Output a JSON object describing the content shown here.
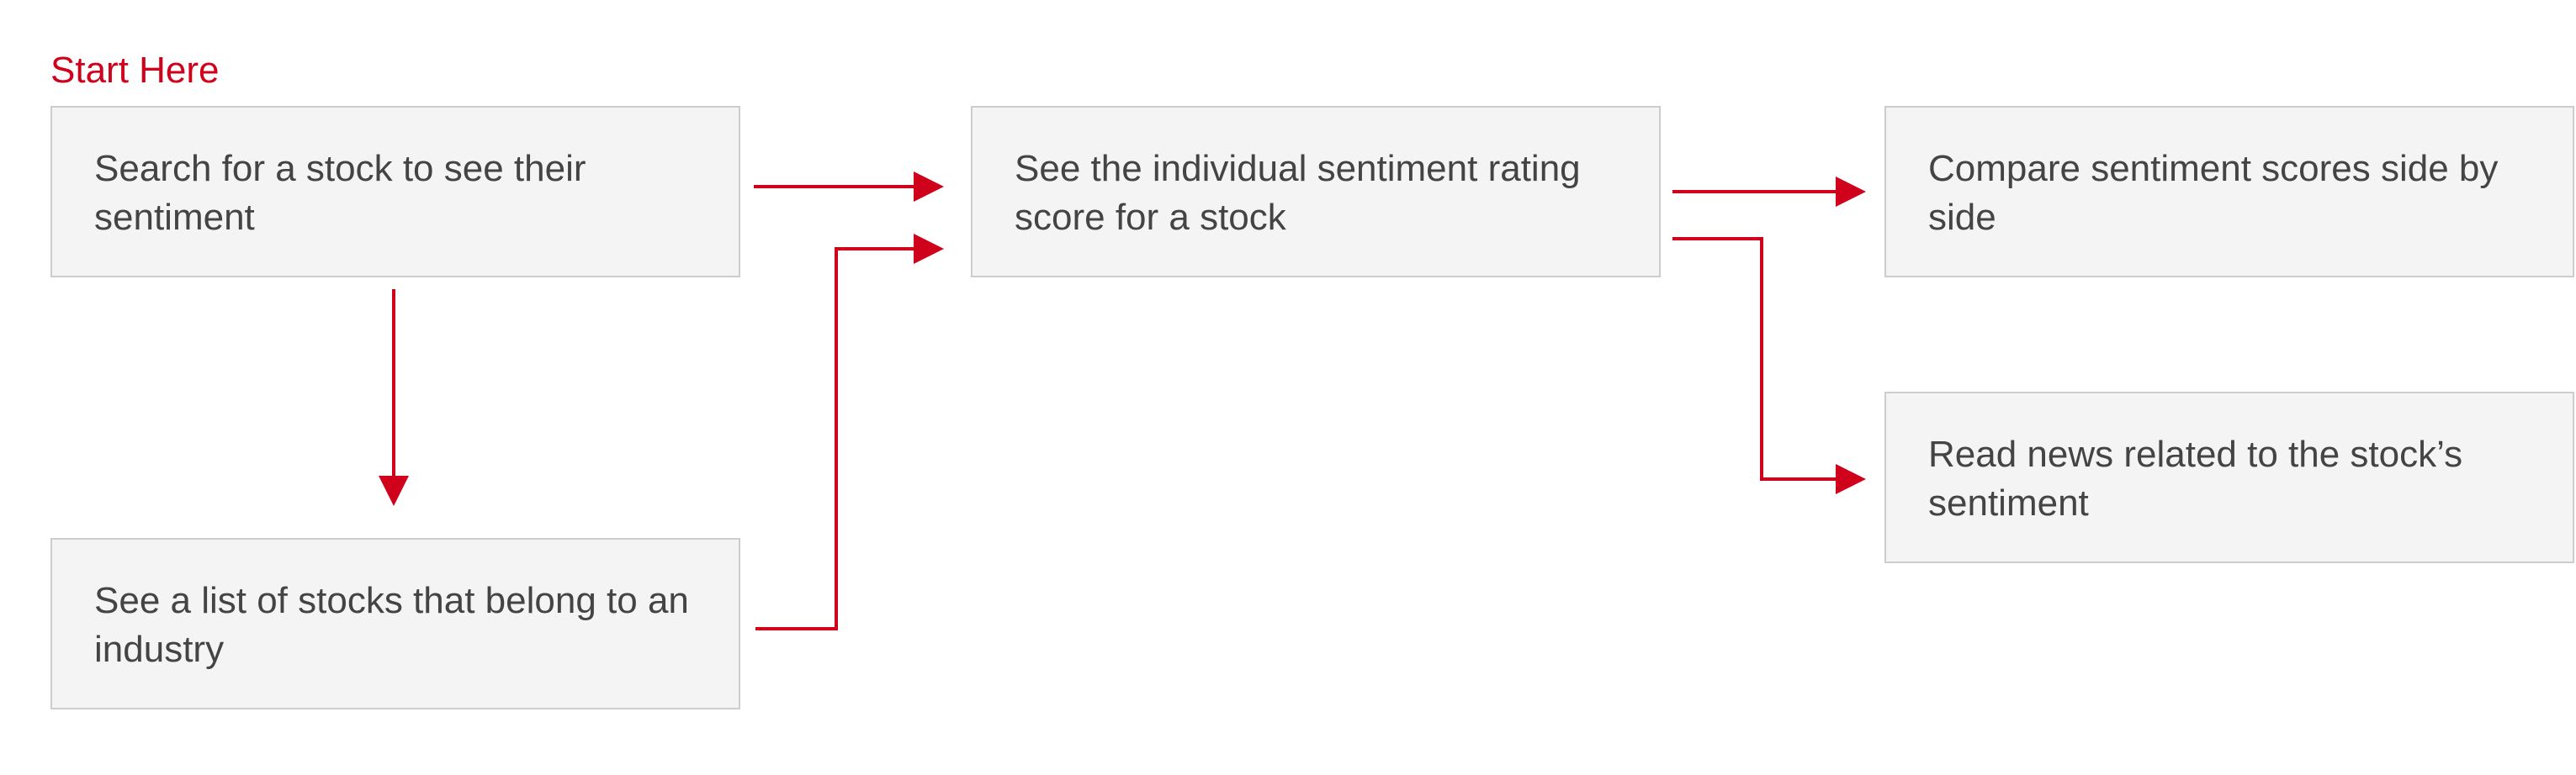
{
  "start_label": "Start Here",
  "steps": {
    "search": "Search for a stock to see their sentiment",
    "industry": "See a list of stocks that belong to an industry",
    "rating": "See the individual sentiment rating score for a stock",
    "compare": "Compare sentiment scores side by side",
    "news": "Read news related to the stock’s sentiment"
  },
  "colors": {
    "accent": "#D0021B",
    "box_fill": "#F4F4F4",
    "box_border": "#CDCDCD",
    "text": "#444444"
  }
}
